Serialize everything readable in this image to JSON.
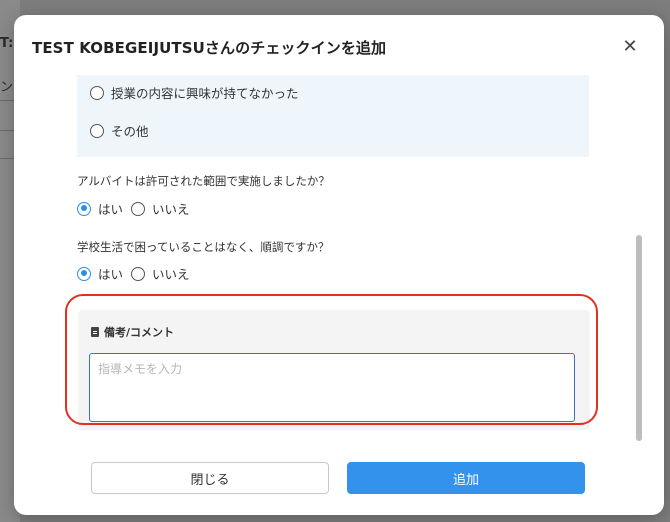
{
  "background": {
    "fragments": [
      "T:",
      "ン"
    ]
  },
  "modal": {
    "title": "TEST KOBEGEIJUTSUさんのチェックインを追加",
    "close_symbol": "✕"
  },
  "prev_question": {
    "options": [
      {
        "label": "授業の内容に興味が持てなかった",
        "checked": false
      },
      {
        "label": "その他",
        "checked": false
      }
    ]
  },
  "q_arbeit": {
    "label": "アルバイトは許可された範囲で実施しましたか？",
    "options": [
      {
        "label": "はい",
        "checked": true
      },
      {
        "label": "いいえ",
        "checked": false
      }
    ]
  },
  "q_school": {
    "label": "学校生活で困っていることはなく、順調ですか？",
    "options": [
      {
        "label": "はい",
        "checked": true
      },
      {
        "label": "いいえ",
        "checked": false
      }
    ]
  },
  "comment": {
    "label": "備考/コメント",
    "placeholder": "指導メモを入力",
    "value": ""
  },
  "footer": {
    "close_label": "閉じる",
    "add_label": "追加"
  },
  "colors": {
    "accent": "#3393ec",
    "highlight": "#e2321f",
    "option_bg": "#eef6fc"
  }
}
